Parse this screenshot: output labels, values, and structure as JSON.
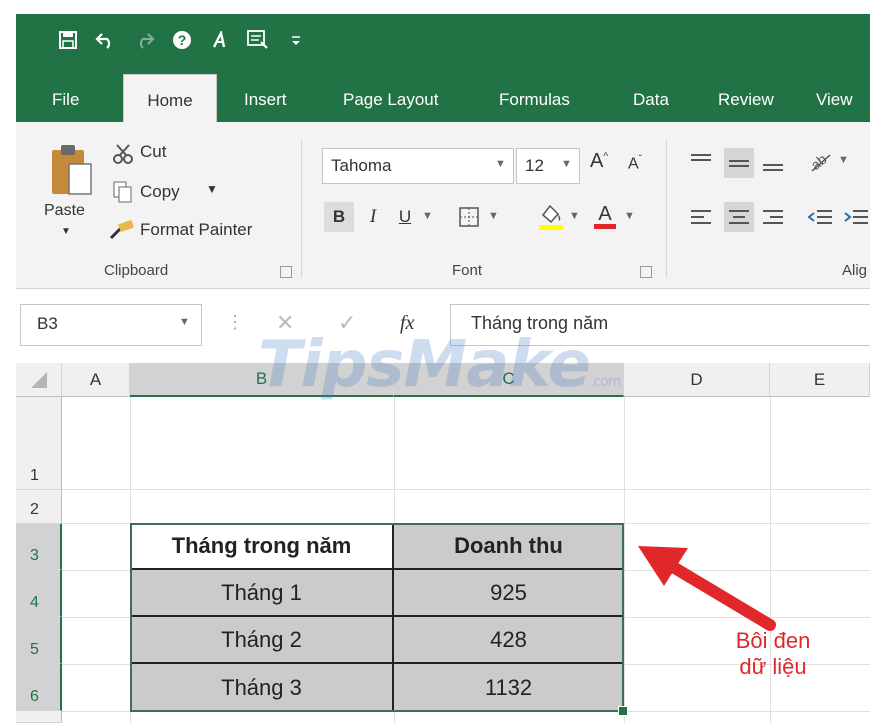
{
  "tabs": [
    "File",
    "Home",
    "Insert",
    "Page Layout",
    "Formulas",
    "Data",
    "Review",
    "View"
  ],
  "clipboard": {
    "paste": "Paste",
    "cut": "Cut",
    "copy": "Copy",
    "format_painter": "Format Painter",
    "group_label": "Clipboard"
  },
  "font": {
    "name": "Tahoma",
    "size": "12",
    "group_label": "Font"
  },
  "alignment": {
    "group_label": "Alig"
  },
  "formula_bar": {
    "name_box": "B3",
    "fx": "fx",
    "content": "Tháng trong năm"
  },
  "columns": [
    "A",
    "B",
    "C",
    "D",
    "E"
  ],
  "rows": [
    "1",
    "2",
    "3",
    "4",
    "5",
    "6"
  ],
  "table": {
    "headers": [
      "Tháng trong năm",
      "Doanh thu"
    ],
    "rows": [
      [
        "Tháng 1",
        "925"
      ],
      [
        "Tháng 2",
        "428"
      ],
      [
        "Tháng 3",
        "1132"
      ]
    ]
  },
  "annotation": {
    "line1": "Bôi đen",
    "line2": "dữ liệu"
  },
  "watermark": {
    "main": "TipsMake",
    "suffix": ".com"
  },
  "colors": {
    "excel_green": "#217346",
    "arrow_red": "#e0282a",
    "selection_gray": "#cbcbcb"
  }
}
